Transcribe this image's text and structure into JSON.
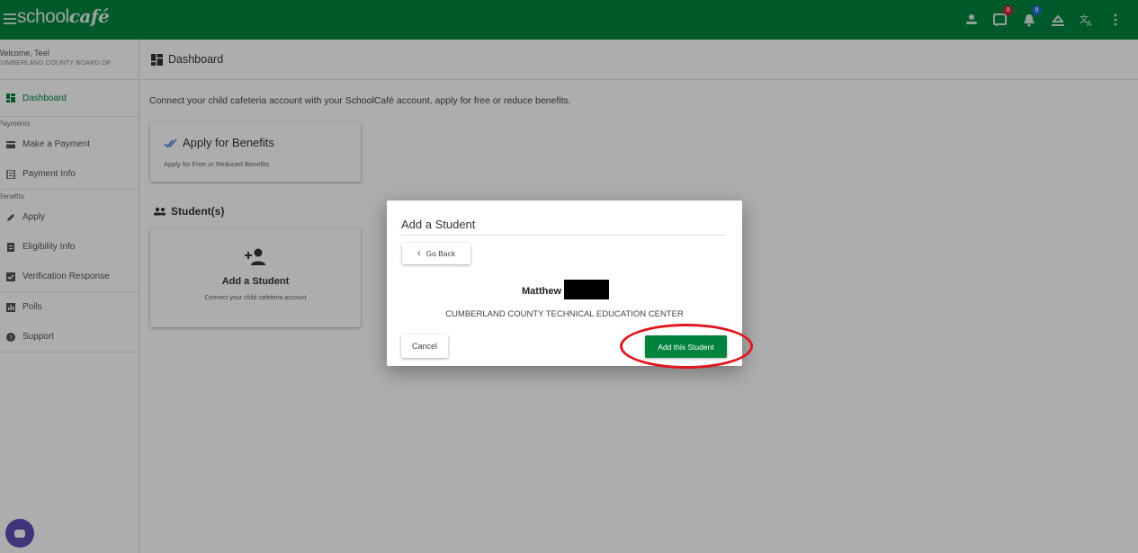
{
  "app": {
    "logo_text_left": "school",
    "logo_text_right": "café",
    "brand_color": "#00843d",
    "top_icons": [
      {
        "name": "account-icon"
      },
      {
        "name": "messages-icon",
        "badge": "0",
        "badge_color": "#d0243c"
      },
      {
        "name": "notifications-icon",
        "badge": "0",
        "badge_color": "#1f6fd1"
      },
      {
        "name": "accessibility-icon"
      },
      {
        "name": "translate-icon"
      },
      {
        "name": "more-vert-icon"
      }
    ]
  },
  "sidebar": {
    "welcome_line": "Welcome, Teel",
    "district_line": "CUMBERLAND COUNTY BOARD OF",
    "dashboard_label": "Dashboard",
    "payments_section": "Payments",
    "make_payment_label": "Make a Payment",
    "payment_info_label": "Payment Info",
    "benefits_section": "Benefits",
    "apply_label": "Apply",
    "eligibility_label": "Eligibility Info",
    "verification_label": "Verification Response",
    "polls_label": "Polls",
    "support_label": "Support"
  },
  "main": {
    "header_title": "Dashboard",
    "intro_text": "Connect your child cafeteria account with your SchoolCafé account, apply for free or reduce benefits.",
    "benefits_card": {
      "title": "Apply for Benefits",
      "subtitle": "Apply for Free or Reduced Benefits"
    },
    "students_title": "Student(s)",
    "add_card": {
      "title": "Add a Student",
      "subtitle": "Connect your child cafeteria account"
    }
  },
  "modal": {
    "title": "Add a Student",
    "go_back_label": "Go Back",
    "student_name": "Matthew",
    "school_name": "CUMBERLAND COUNTY TECHNICAL EDUCATION CENTER",
    "cancel_label": "Cancel",
    "add_label": "Add this Student"
  },
  "annotation": {
    "highlight_color": "#e0161e"
  }
}
